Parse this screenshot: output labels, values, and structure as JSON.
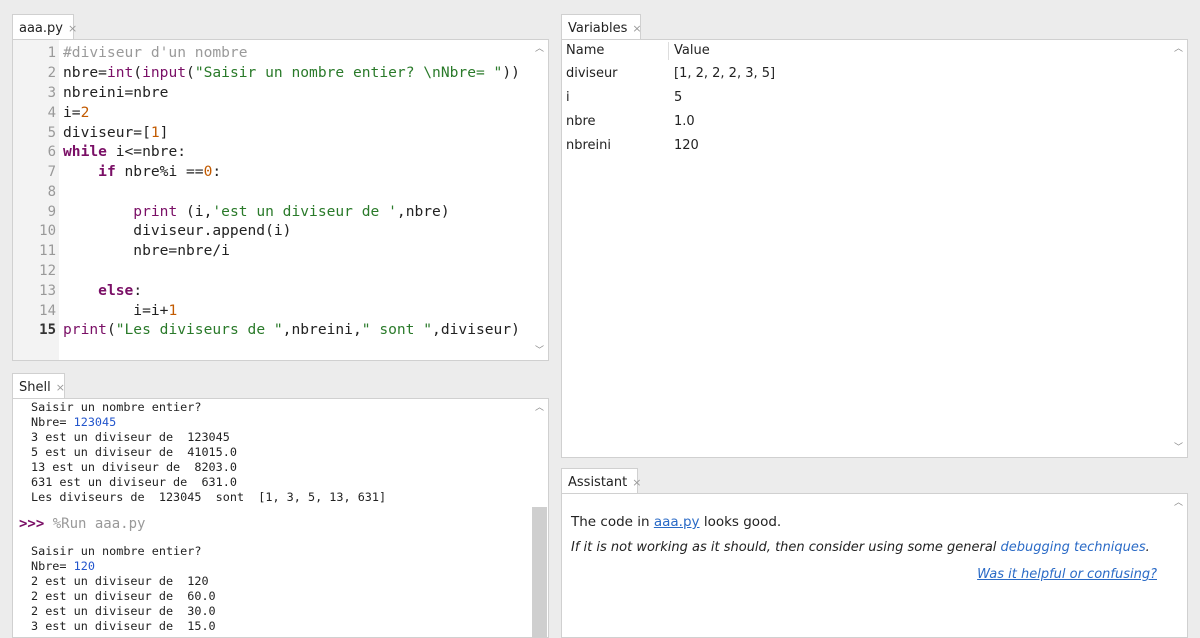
{
  "editor": {
    "tab_label": "aaa.py",
    "tab_close": "×",
    "line_numbers": [
      "1",
      "2",
      "3",
      "4",
      "5",
      "6",
      "7",
      "8",
      "9",
      "10",
      "11",
      "12",
      "13",
      "14",
      "15"
    ],
    "lines": {
      "l1": "#diviseur d'un nombre",
      "l2_a": "nbre=",
      "l2_b": "int",
      "l2_c": "(",
      "l2_d": "input",
      "l2_e": "(",
      "l2_f": "\"Saisir un nombre entier? \\nNbre= \"",
      "l2_g": "))",
      "l3": "nbreini=nbre",
      "l4_a": "i=",
      "l4_b": "2",
      "l5_a": "diviseur=[",
      "l5_b": "1",
      "l5_c": "]",
      "l6_a": "while",
      "l6_b": " i<=nbre:",
      "l7_a": "    ",
      "l7_b": "if",
      "l7_c": " nbre%i ==",
      "l7_d": "0",
      "l7_e": ":",
      "l9_a": "        ",
      "l9_b": "print",
      "l9_c": " (i,",
      "l9_d": "'est un diviseur de '",
      "l9_e": ",nbre)",
      "l10": "        diviseur.append(i)",
      "l11": "        nbre=nbre/i",
      "l13_a": "    ",
      "l13_b": "else",
      "l13_c": ":",
      "l14_a": "        i=i+",
      "l14_b": "1",
      "l15_a": "print",
      "l15_b": "(",
      "l15_c": "\"Les diviseurs de \"",
      "l15_d": ",nbreini,",
      "l15_e": "\" sont \"",
      "l15_f": ",diviseur)"
    }
  },
  "shell": {
    "tab_label": "Shell",
    "tab_close": "×",
    "run1": {
      "line1": "Saisir un nombre entier?",
      "line2_label": "Nbre= ",
      "line2_input": "123045",
      "line3": "3 est un diviseur de  123045",
      "line4": "5 est un diviseur de  41015.0",
      "line5": "13 est un diviseur de  8203.0",
      "line6": "631 est un diviseur de  631.0",
      "line7": "Les diviseurs de  123045  sont  [1, 3, 5, 13, 631]"
    },
    "prompt_symbol": ">>>",
    "prompt_command": " %Run aaa.py",
    "run2": {
      "line1": "Saisir un nombre entier?",
      "line2_label": "Nbre= ",
      "line2_input": "120",
      "line3": "2 est un diviseur de  120",
      "line4": "2 est un diviseur de  60.0",
      "line5": "2 est un diviseur de  30.0",
      "line6": "3 est un diviseur de  15.0"
    }
  },
  "variables": {
    "tab_label": "Variables",
    "tab_close": "×",
    "col_name": "Name",
    "col_value": "Value",
    "rows": [
      {
        "name": "diviseur",
        "value": "[1, 2, 2, 2, 3, 5]"
      },
      {
        "name": "i",
        "value": "5"
      },
      {
        "name": "nbre",
        "value": "1.0"
      },
      {
        "name": "nbreini",
        "value": "120"
      }
    ]
  },
  "assistant": {
    "tab_label": "Assistant",
    "tab_close": "×",
    "line1_pre": "The code in ",
    "line1_link": "aaa.py",
    "line1_post": " looks good.",
    "line2_pre": "If it is not working as it should, then consider using some general ",
    "line2_link": "debugging techniques",
    "line2_post": ".",
    "feedback_link": "Was it helpful or confusing?"
  }
}
